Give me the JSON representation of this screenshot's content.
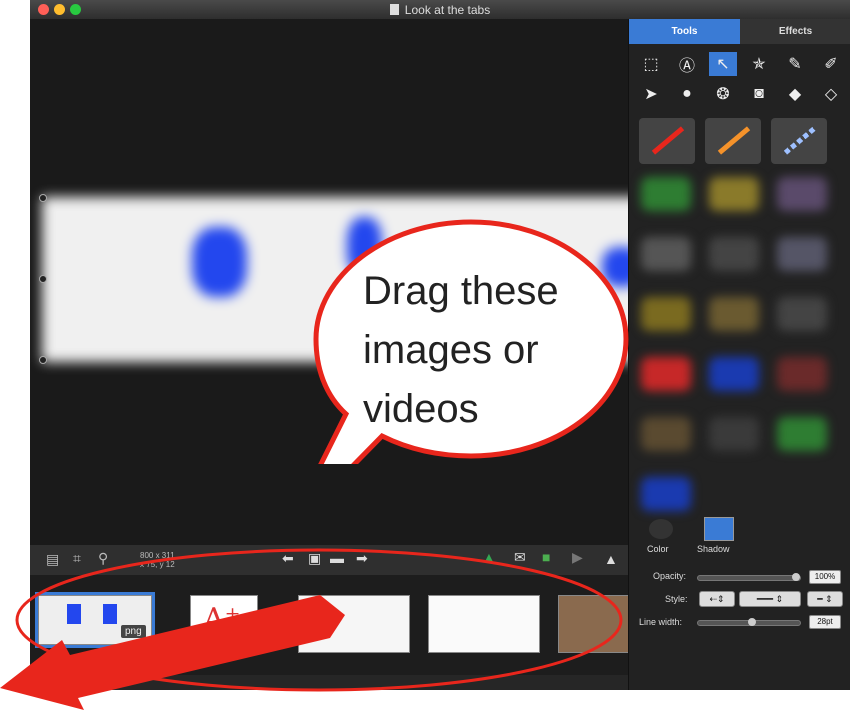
{
  "window": {
    "title": "Look at the tabs",
    "traffic_colors": [
      "#ff5f57",
      "#ffbd2e",
      "#28c940"
    ]
  },
  "panel": {
    "tabs": [
      {
        "label": "Tools"
      },
      {
        "label": "Effects"
      }
    ],
    "tools": [
      "selection-icon",
      "speech-bubble-icon",
      "arrow-icon",
      "star-stamp-icon",
      "pen-icon",
      "highlighter-icon",
      "pointer-icon",
      "drop-icon",
      "blur-icon",
      "spotlight-icon",
      "fill-icon",
      "eraser-icon"
    ],
    "color_label": "Color",
    "shadow_label": "Shadow",
    "opacity_label": "Opacity:",
    "opacity_value": "100%",
    "style_label": "Style:",
    "line_width_label": "Line width:",
    "line_width_value": "28pt"
  },
  "toolbar": {
    "coords_line1": "800 x 311",
    "coords_line2": "x 75, y 12"
  },
  "tray": {
    "selected_badge": "png"
  },
  "annotation": {
    "bubble_text": "Drag these images or videos"
  },
  "colors": {
    "accent": "#3a7bd5",
    "annotation_red": "#e8261c"
  }
}
